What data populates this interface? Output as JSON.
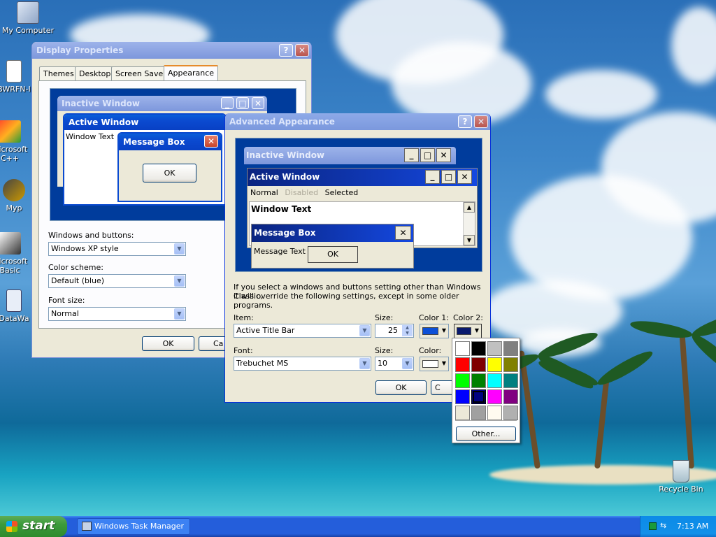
{
  "desktop": {
    "icons": [
      "My Computer",
      "BWRFN-I",
      "Microsoft C++",
      "Myp",
      "Microsoft Basic",
      "DataWa",
      "Recycle Bin"
    ]
  },
  "display_properties": {
    "title": "Display Properties",
    "tabs": [
      "Themes",
      "Desktop",
      "Screen Saver",
      "Appearance"
    ],
    "selected_tab": "Appearance",
    "preview": {
      "inactive_title": "Inactive Window",
      "active_title": "Active Window",
      "window_text": "Window Text",
      "msgbox_title": "Message Box",
      "msgbox_ok": "OK"
    },
    "windows_buttons_label": "Windows and buttons:",
    "windows_buttons_value": "Windows XP style",
    "color_scheme_label": "Color scheme:",
    "color_scheme_value": "Default (blue)",
    "font_size_label": "Font size:",
    "font_size_value": "Normal",
    "ok_label": "OK",
    "cancel_label": "Ca"
  },
  "advanced_appearance": {
    "title": "Advanced Appearance",
    "preview": {
      "inactive_title": "Inactive Window",
      "active_title": "Active Window",
      "menu_normal": "Normal",
      "menu_disabled": "Disabled",
      "menu_selected": "Selected",
      "window_text": "Window Text",
      "msgbox_title": "Message Box",
      "msgbox_text": "Message Text",
      "msgbox_ok": "OK"
    },
    "info_text_1": "If you select a windows and buttons setting other than Windows Classic,",
    "info_text_2": "it will override the following settings, except in some older programs.",
    "item_label": "Item:",
    "item_value": "Active Title Bar",
    "size_label": "Size:",
    "size_value": "25",
    "color1_label": "Color 1:",
    "color2_label": "Color 2:",
    "font_label": "Font:",
    "font_value": "Trebuchet MS",
    "font_size_label": "Size:",
    "font_size_value": "10",
    "font_color_label": "Color:",
    "ok_label": "OK",
    "cancel_label": "C"
  },
  "color_picker": {
    "other_label": "Other..."
  },
  "taskbar": {
    "start_label": "start",
    "task_label": "Windows Task Manager",
    "clock": "7:13 AM"
  },
  "colors": {
    "color1": "#0a4fd8",
    "color2": "#0a1a6e",
    "font_color": "#ffffff",
    "palette": [
      "#ffffff",
      "#000000",
      "#c0c0c0",
      "#808080",
      "#ff0000",
      "#800000",
      "#ffff00",
      "#808000",
      "#00ff00",
      "#008000",
      "#00ffff",
      "#008080",
      "#0000ff",
      "#000080",
      "#ff00ff",
      "#800080",
      "#ece9d8",
      "#a0a0a0",
      "#fffbf0",
      "#b0b0b0"
    ],
    "selected_swatch": 13
  }
}
